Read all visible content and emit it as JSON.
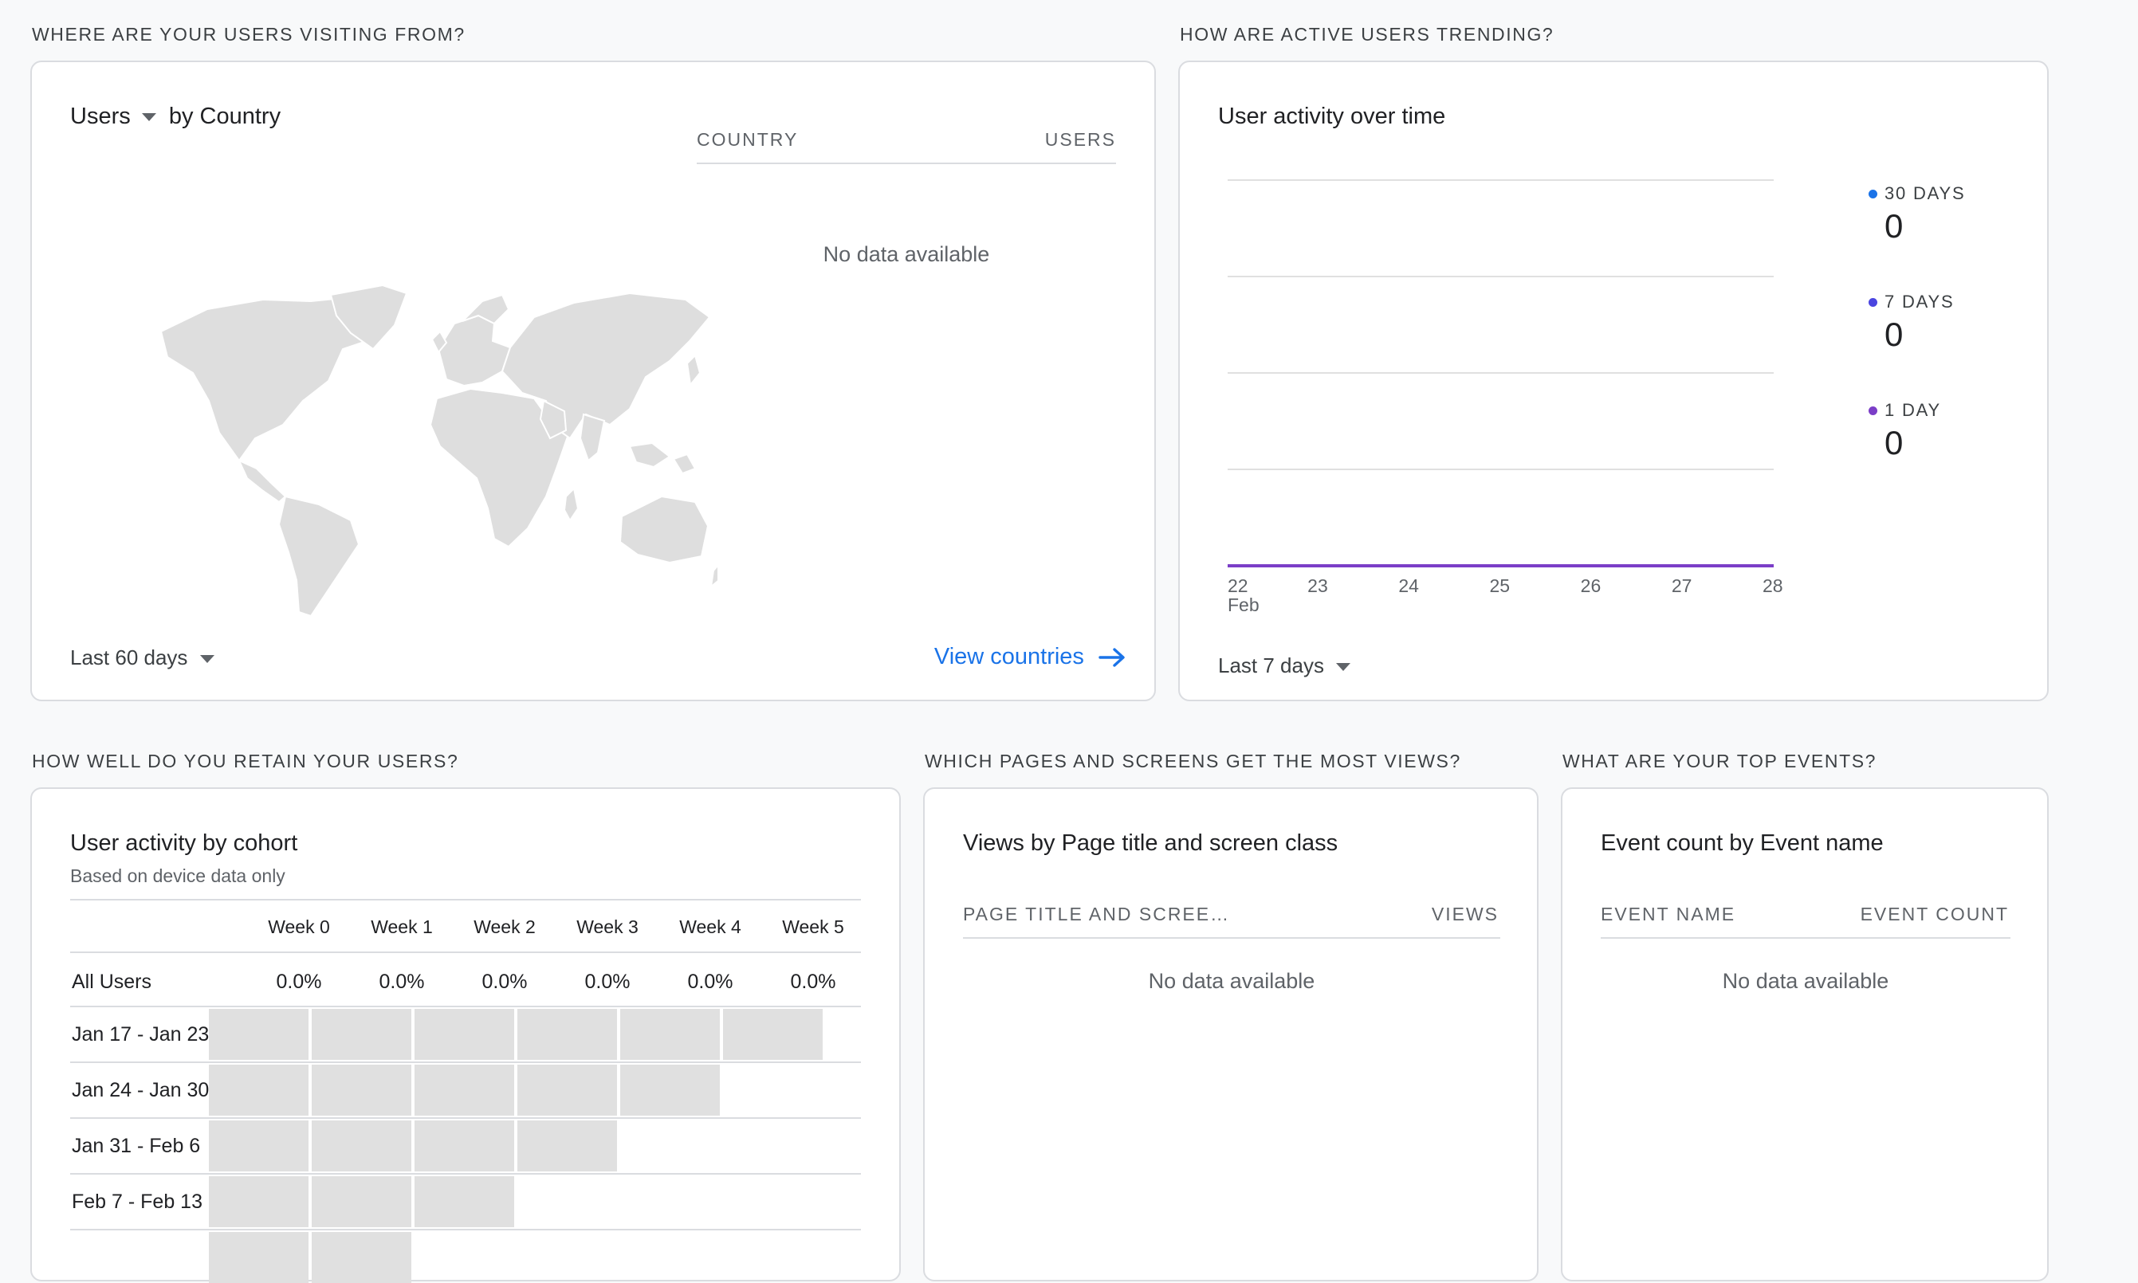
{
  "sections": {
    "visiting": "WHERE ARE YOUR USERS VISITING FROM?",
    "trending": "HOW ARE ACTIVE USERS TRENDING?",
    "retain": "HOW WELL DO YOU RETAIN YOUR USERS?",
    "pages": "WHICH PAGES AND SCREENS GET THE MOST VIEWS?",
    "events": "WHAT ARE YOUR TOP EVENTS?"
  },
  "country_card": {
    "metric": "Users",
    "by": "by Country",
    "col_country": "COUNTRY",
    "col_users": "USERS",
    "empty": "No data available",
    "range": "Last 60 days",
    "link": "View countries",
    "map_icon": "world-map-icon"
  },
  "trend_card": {
    "title": "User activity over time",
    "range": "Last 7 days",
    "line_color": "#7b3ec7",
    "x_ticks": [
      "22",
      "23",
      "24",
      "25",
      "26",
      "27",
      "28"
    ],
    "x_month": "Feb",
    "legend": [
      {
        "label": "30 DAYS",
        "value": "0",
        "color": "#1a73e8"
      },
      {
        "label": "7 DAYS",
        "value": "0",
        "color": "#4a45e0"
      },
      {
        "label": "1 DAY",
        "value": "0",
        "color": "#7b3ec7"
      }
    ]
  },
  "chart_data": {
    "type": "line",
    "x": [
      "22",
      "23",
      "24",
      "25",
      "26",
      "27",
      "28"
    ],
    "series": [
      {
        "name": "30 DAYS",
        "values": [
          0,
          0,
          0,
          0,
          0,
          0,
          0
        ]
      },
      {
        "name": "7 DAYS",
        "values": [
          0,
          0,
          0,
          0,
          0,
          0,
          0
        ]
      },
      {
        "name": "1 DAY",
        "values": [
          0,
          0,
          0,
          0,
          0,
          0,
          0
        ]
      }
    ],
    "title": "User activity over time",
    "grid": true,
    "legend": "right"
  },
  "cohort_card": {
    "title": "User activity by cohort",
    "subtitle": "Based on device data only",
    "weeks": [
      "Week 0",
      "Week 1",
      "Week 2",
      "Week 3",
      "Week 4",
      "Week 5"
    ],
    "all_users_label": "All Users",
    "all_users": [
      "0.0%",
      "0.0%",
      "0.0%",
      "0.0%",
      "0.0%",
      "0.0%"
    ],
    "cohorts": [
      {
        "label": "Jan 17 - Jan 23",
        "filled": 6
      },
      {
        "label": "Jan 24 - Jan 30",
        "filled": 5
      },
      {
        "label": "Jan 31 - Feb 6",
        "filled": 4
      },
      {
        "label": "Feb 7 - Feb 13",
        "filled": 3
      },
      {
        "label": "",
        "filled": 2
      }
    ]
  },
  "pages_card": {
    "title": "Views by Page title and screen class",
    "col_page": "PAGE TITLE AND SCREE…",
    "col_views": "VIEWS",
    "empty": "No data available"
  },
  "events_card": {
    "title": "Event count by Event name",
    "col_name": "EVENT NAME",
    "col_count": "EVENT COUNT",
    "empty": "No data available"
  }
}
